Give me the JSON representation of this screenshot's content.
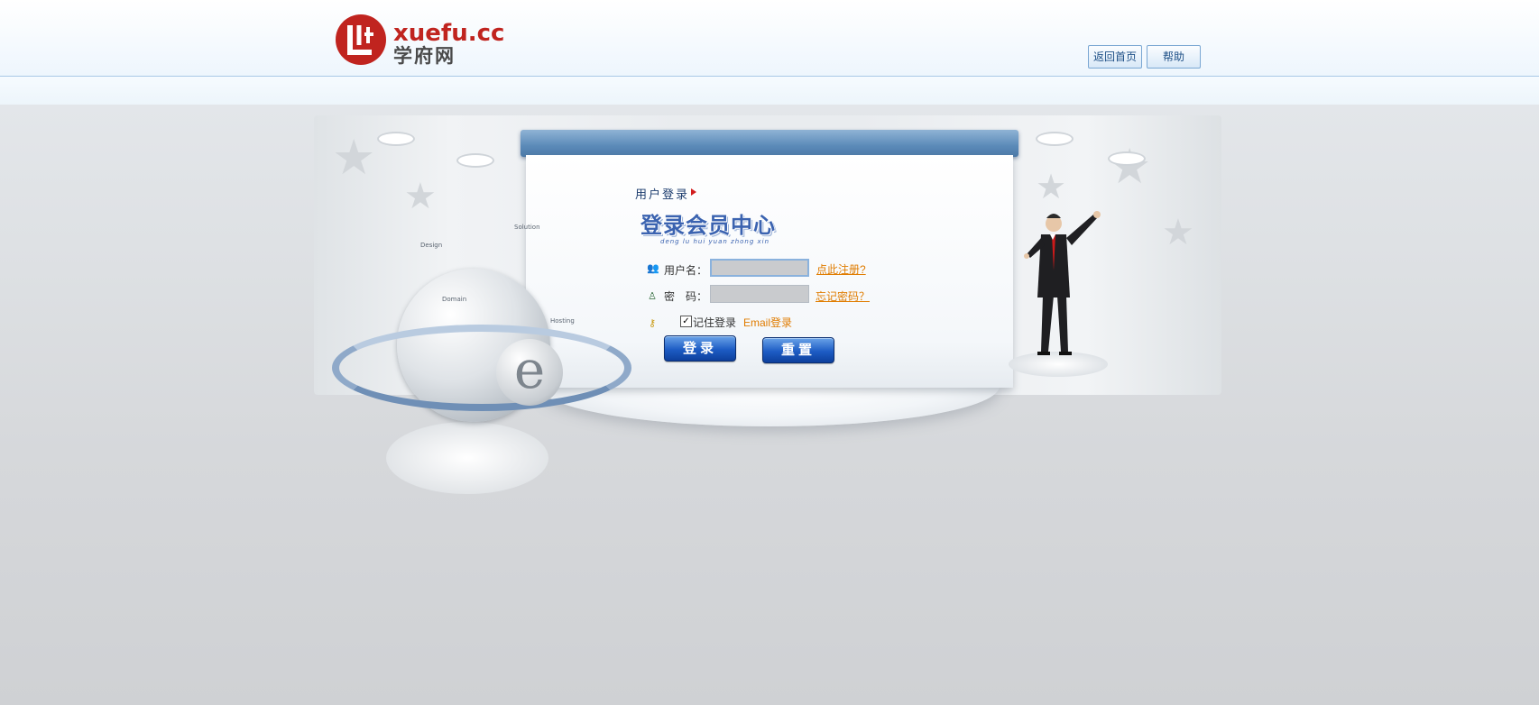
{
  "header": {
    "logo_text": "xuefu.cc",
    "logo_cn": "学府网",
    "home_button": "返回首页",
    "help_button": "帮助"
  },
  "globe_tags": {
    "design": "Design",
    "solution": "Solution",
    "domain": "Domain",
    "hosting": "Hosting"
  },
  "login": {
    "section_title": "用户登录",
    "heading": "登录会员中心",
    "heading_pinyin": "deng lu hui yuan zhong xin",
    "username_label": "用户名：",
    "username_value": "",
    "password_label": "密　码：",
    "password_value": "",
    "register_link": "点此注册?",
    "forgot_link": "忘记密码？",
    "remember_label": "记住登录",
    "remember_checked": true,
    "email_link": "Email登录",
    "login_button": "登录",
    "reset_button": "重置"
  },
  "colors": {
    "brand_red": "#c0241f",
    "link_orange": "#e07c00",
    "button_blue": "#1d5cc4",
    "header_border": "#a9c8e6"
  }
}
